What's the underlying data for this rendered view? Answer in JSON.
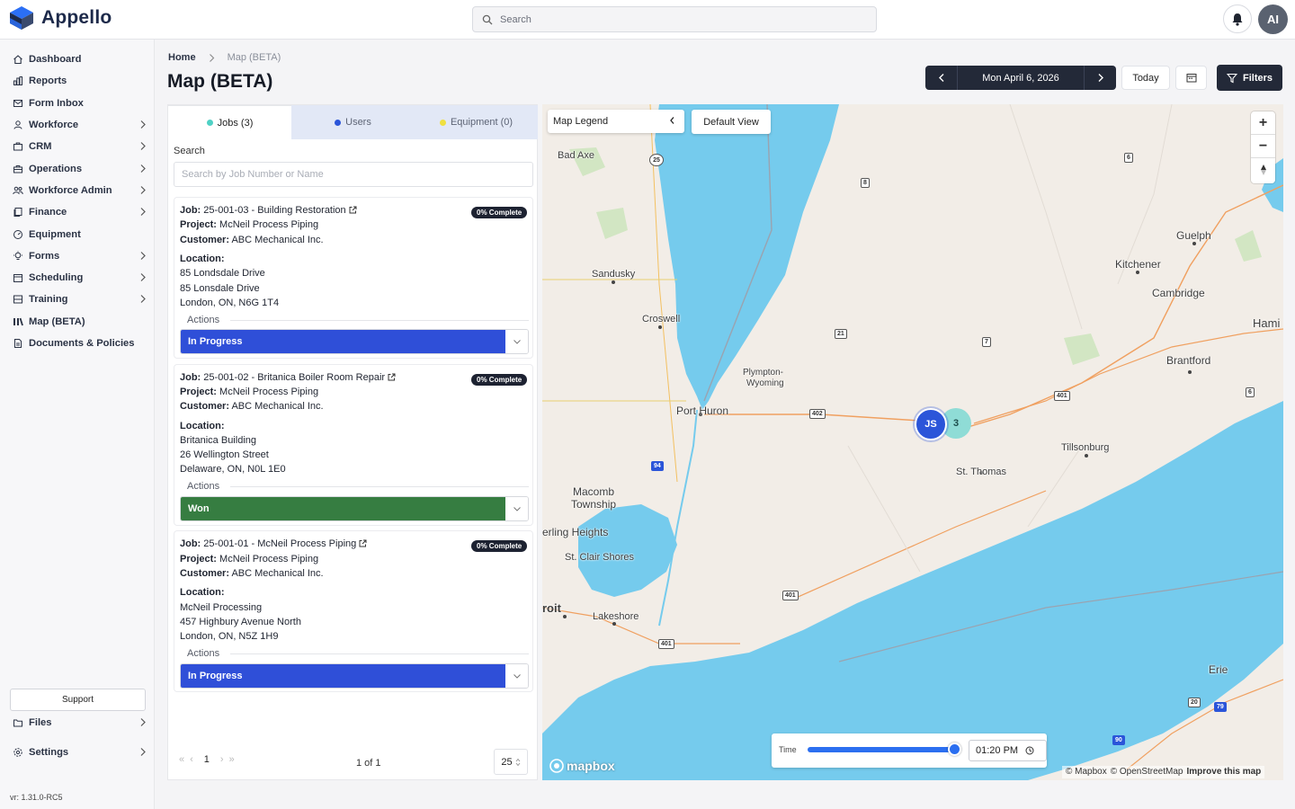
{
  "app": {
    "name": "Appello",
    "user_initials": "AI"
  },
  "search": {
    "placeholder": "Search"
  },
  "sidebar": {
    "items": [
      {
        "label": "Dashboard",
        "icon": "home-icon"
      },
      {
        "label": "Reports",
        "icon": "bar-chart-icon"
      },
      {
        "label": "Form Inbox",
        "icon": "inbox-icon"
      },
      {
        "label": "Workforce",
        "icon": "users-icon"
      },
      {
        "label": "CRM",
        "icon": "briefcase-icon"
      },
      {
        "label": "Operations",
        "icon": "toolbox-icon"
      },
      {
        "label": "Workforce Admin",
        "icon": "user-group-icon"
      },
      {
        "label": "Finance",
        "icon": "document-stack-icon"
      },
      {
        "label": "Equipment",
        "icon": "gauge-icon"
      },
      {
        "label": "Forms",
        "icon": "bulb-icon"
      },
      {
        "label": "Scheduling",
        "icon": "calendar-icon"
      },
      {
        "label": "Training",
        "icon": "layers-icon"
      },
      {
        "label": "Map (BETA)",
        "icon": "map-bars-icon"
      },
      {
        "label": "Documents & Policies",
        "icon": "document-icon"
      }
    ],
    "support_label": "Support",
    "files_label": "Files",
    "settings_label": "Settings",
    "version": "vr: 1.31.0-RC5"
  },
  "breadcrumb": {
    "home": "Home",
    "current": "Map (BETA)"
  },
  "page": {
    "title": "Map (BETA)"
  },
  "toolbar": {
    "date": "Mon April 6, 2026",
    "today_label": "Today",
    "filters_label": "Filters"
  },
  "tabs": [
    {
      "label": "Jobs (3)",
      "dot_color": "#4fd1c5"
    },
    {
      "label": "Users",
      "dot_color": "#2b55d9"
    },
    {
      "label": "Equipment (0)",
      "dot_color": "#f0e040"
    }
  ],
  "job_search": {
    "label": "Search",
    "placeholder": "Search by Job Number or Name"
  },
  "labels": {
    "job": "Job:",
    "project": "Project:",
    "customer": "Customer:",
    "location": "Location:",
    "actions": "Actions"
  },
  "jobs": [
    {
      "title": "25-001-03 - Building Restoration",
      "badge": "0% Complete",
      "project": "McNeil Process Piping",
      "customer": "ABC Mechanical Inc.",
      "location": [
        "85 Londsdale Drive",
        "85 Lonsdale Drive",
        "London, ON, N6G 1T4"
      ],
      "status": "In Progress",
      "status_color": "#2f4fd8"
    },
    {
      "title": "25-001-02 - Britanica Boiler Room Repair",
      "badge": "0% Complete",
      "project": "McNeil Process Piping",
      "customer": "ABC Mechanical Inc.",
      "location": [
        "Britanica Building",
        "26 Wellington Street",
        "Delaware, ON, N0L 1E0"
      ],
      "status": "Won",
      "status_color": "#367d41"
    },
    {
      "title": "25-001-01 - McNeil Process Piping",
      "badge": "0% Complete",
      "project": "McNeil Process Piping",
      "customer": "ABC Mechanical Inc.",
      "location": [
        "McNeil Processing",
        "457 Highbury Avenue North",
        "London, ON, N5Z 1H9"
      ],
      "status": "In Progress",
      "status_color": "#2f4fd8"
    }
  ],
  "pagination": {
    "current": "1",
    "summary": "1 of 1",
    "page_size": "25"
  },
  "map": {
    "legend_label": "Map Legend",
    "default_view_label": "Default View",
    "places": [
      "Bad Axe",
      "Sandusky",
      "Croswell",
      "Port Huron",
      "Plympton-",
      "Wyoming",
      "Macomb",
      "Township",
      "erling Heights",
      "St. Clair Shores",
      "roit",
      "Lakeshore",
      "Guelph",
      "Kitchener",
      "Cambridge",
      "Hami",
      "Brantford",
      "Tillsonburg",
      "St. Thomas",
      "Erie"
    ],
    "shields": [
      "25",
      "8",
      "6",
      "21",
      "7",
      "402",
      "401",
      "6",
      "94",
      "401",
      "401",
      "20",
      "79",
      "90"
    ],
    "clusters": {
      "user": "JS",
      "jobs": "3"
    },
    "time_label": "Time",
    "time_value": "01:20  PM",
    "time_progress": 1.0,
    "brand": "mapbox",
    "attribution": [
      "© Mapbox",
      "© OpenStreetMap",
      "Improve this map"
    ]
  },
  "colors": {
    "water": "#75cbed",
    "land": "#f2ede7",
    "dark": "#232938",
    "accent": "#2f4fd8"
  }
}
